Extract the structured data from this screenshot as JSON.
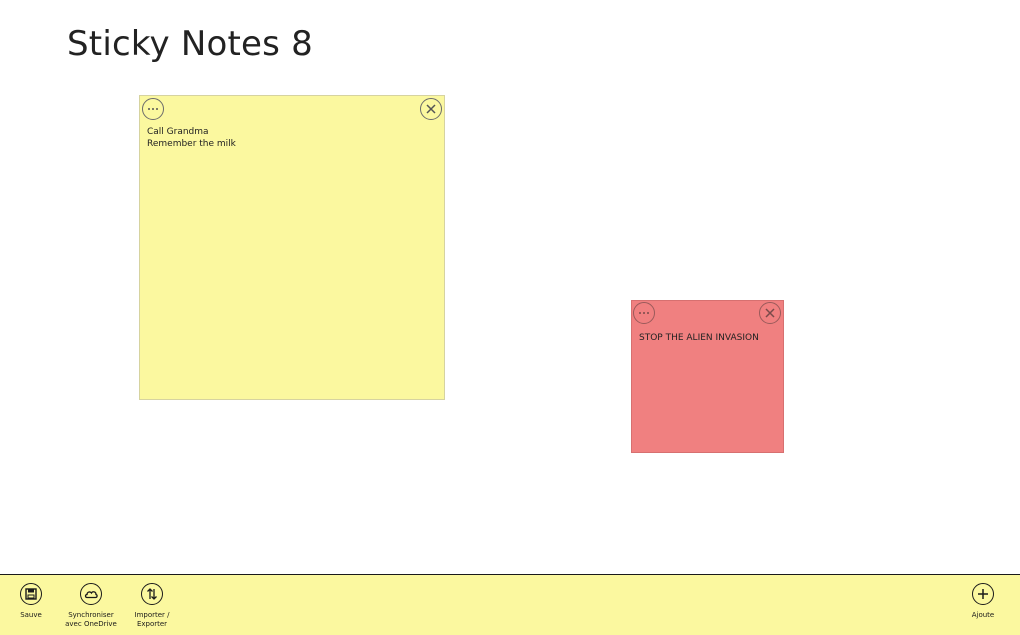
{
  "app": {
    "title": "Sticky Notes 8"
  },
  "notes": [
    {
      "color": "#fbf89f",
      "text": "Call Grandma\nRemember the milk"
    },
    {
      "color": "#f08080",
      "text": "STOP THE ALIEN INVASION"
    }
  ],
  "appbar": {
    "save_label": "Sauve",
    "sync_label": "Synchroniser\navec OneDrive",
    "import_export_label": "Importer /\nExporter",
    "add_label": "Ajoute"
  },
  "icons": {
    "note_menu": "more-icon",
    "note_close": "close-icon",
    "save": "save-icon",
    "sync": "cloud-icon",
    "import_export": "import-export-icon",
    "add": "add-icon"
  }
}
